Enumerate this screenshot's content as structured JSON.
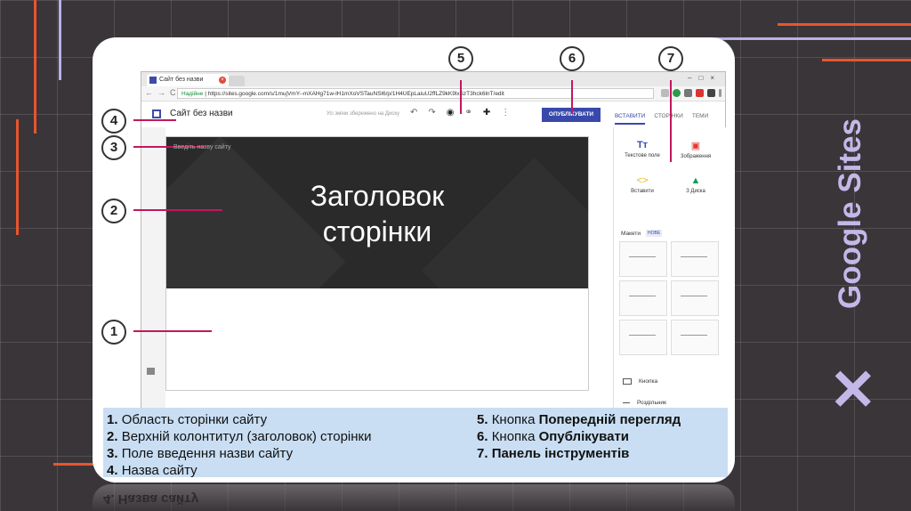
{
  "browser": {
    "tab_title": "Сайт без назви",
    "secure_label": "Надійне",
    "url": "https://sites.google.com/s/1mujVmY--mXAHg71w-lH1mXoVSTauNSl6/p/1H4UEpLaiuU2ffLZ9kK9lxSzT3hck6lnT/edit"
  },
  "sites": {
    "site_name": "Сайт без назви",
    "saved_status": "Усі зміни збережено на Диску",
    "publish_label": "ОПУБЛІКУВАТИ",
    "page_title_line1": "Заголовок",
    "page_title_line2": "сторінки",
    "site_name_placeholder": "Введіть назву сайту"
  },
  "panel": {
    "tabs": [
      "ВСТАВИТИ",
      "СТОРІНКИ",
      "ТЕМИ"
    ],
    "tools": [
      {
        "label": "Текстове поле",
        "icon": "text-box-icon"
      },
      {
        "label": "Зображення",
        "icon": "image-icon"
      },
      {
        "label": "Вставити",
        "icon": "embed-icon"
      },
      {
        "label": "З Диска",
        "icon": "drive-icon"
      }
    ],
    "layouts_label": "Макети",
    "new_badge": "НОВЕ",
    "items": [
      "Кнопка",
      "Роздільник"
    ]
  },
  "callouts": [
    "1",
    "2",
    "3",
    "4",
    "5",
    "6",
    "7"
  ],
  "legend": {
    "left": [
      {
        "num": "1.",
        "text": "Область сторінки сайту"
      },
      {
        "num": "2.",
        "text": "Верхній колонтитул (заголовок) сторінки"
      },
      {
        "num": "3.",
        "text": "Поле введення назви сайту"
      },
      {
        "num": "4.",
        "text": "Назва сайту"
      }
    ],
    "right": [
      {
        "num": "5.",
        "pre": "Кнопка ",
        "bold": "Попередній перегляд"
      },
      {
        "num": "6.",
        "pre": "Кнопка ",
        "bold": "Опублікувати"
      },
      {
        "num": "7.",
        "pre": "",
        "bold": "Панель інструментів"
      }
    ]
  },
  "side_title": "Google Sites",
  "reflection": "4. Назва сайту",
  "colors": {
    "accent": "#3949ab",
    "callout_line": "#c2185b",
    "legend_bg": "#c9def3",
    "title": "#c3b8e8",
    "deco_orange": "#e8552e"
  }
}
